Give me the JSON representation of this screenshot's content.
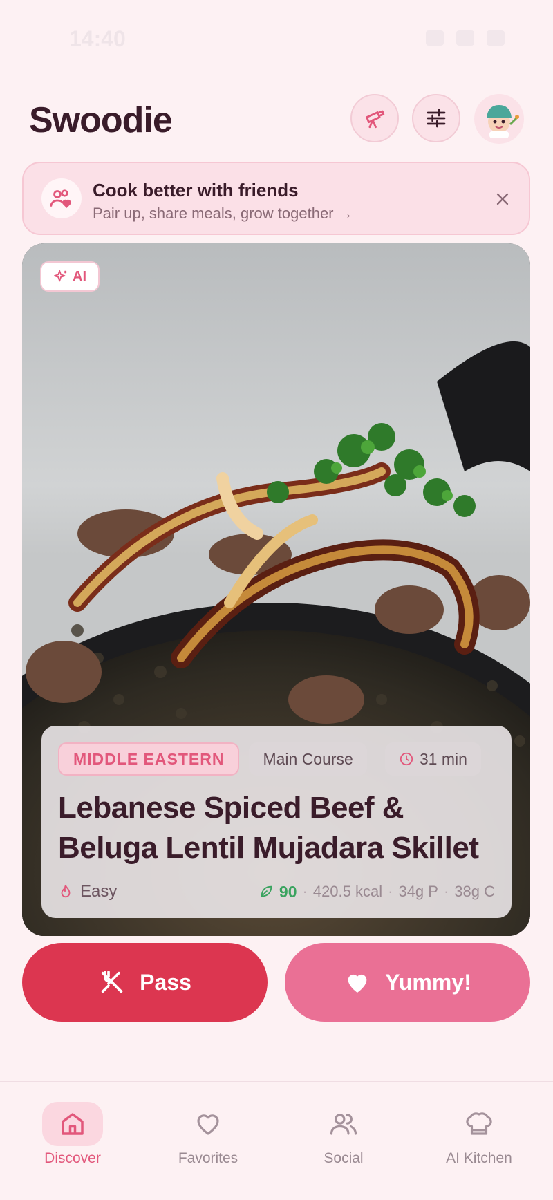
{
  "status": {
    "time": "14:40"
  },
  "header": {
    "title": "Swoodie",
    "icons": [
      "telescope-icon",
      "sliders-icon",
      "chef-avatar"
    ]
  },
  "banner": {
    "title": "Cook better with friends",
    "subtitle": "Pair up, share meals, grow together →"
  },
  "card": {
    "ai_label": "AI",
    "cuisine": "MIDDLE EASTERN",
    "course": "Main Course",
    "time": "31 min",
    "title": "Lebanese Spiced Beef & Beluga Lentil Mujadara Skillet",
    "difficulty": "Easy",
    "health_score": "90",
    "calories": "420.5 kcal",
    "protein": "34g P",
    "carbs": "38g C"
  },
  "actions": {
    "pass_label": "Pass",
    "yummy_label": "Yummy!"
  },
  "nav": {
    "items": [
      {
        "label": "Discover",
        "icon": "home-icon",
        "active": true
      },
      {
        "label": "Favorites",
        "icon": "heart-icon"
      },
      {
        "label": "Social",
        "icon": "users-icon"
      },
      {
        "label": "AI Kitchen",
        "icon": "chef-hat-icon"
      }
    ]
  },
  "colors": {
    "accent": "#e2577b",
    "pass": "#dc3650",
    "yummy": "#ea7095",
    "health": "#3aa35f"
  }
}
